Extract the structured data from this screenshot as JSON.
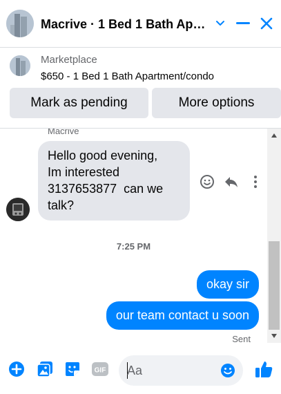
{
  "header": {
    "title": "Macrive · 1 Bed 1 Bath Apa...",
    "icons": {
      "chevron": "chevron-down-icon",
      "minimize": "minimize-icon",
      "close": "close-icon"
    }
  },
  "marketplace": {
    "label": "Marketplace",
    "listing": "$650 - 1 Bed 1 Bath Apartment/condo",
    "buttons": {
      "pending": "Mark as pending",
      "more": "More options"
    }
  },
  "thread": {
    "sender": "Macrive",
    "incoming": [
      "Hello good evening,",
      "Im interested",
      "3137653877  can we",
      "talk?"
    ],
    "timestamp": "7:25 PM",
    "outgoing": [
      "okay sir",
      "our team contact u soon"
    ],
    "status": "Sent"
  },
  "composer": {
    "placeholder": "Aa",
    "gif_label": "GIF"
  },
  "colors": {
    "accent": "#0084ff",
    "bubble_in": "#e4e6eb",
    "muted_text": "#65676b"
  }
}
